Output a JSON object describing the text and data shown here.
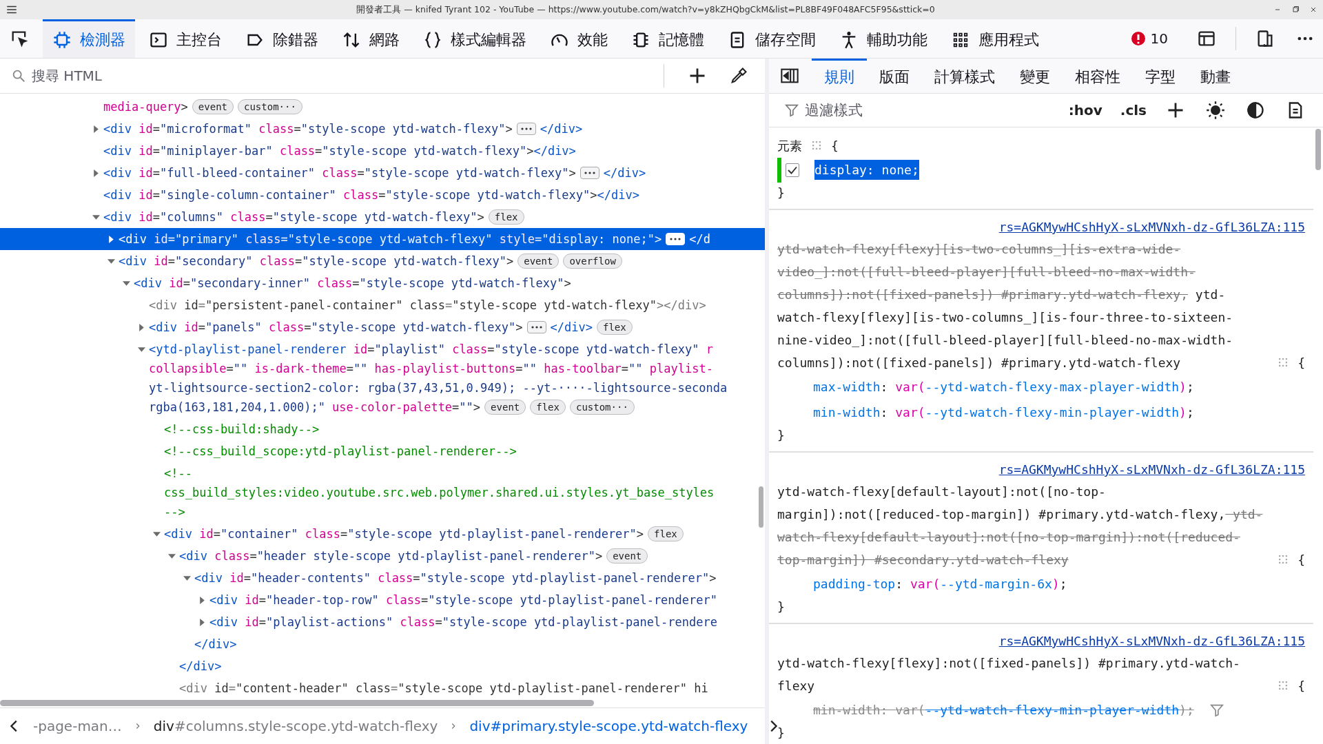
{
  "window": {
    "title": "開發者工具 — knifed Tyrant 102 - YouTube — https://www.youtube.com/watch?v=y8kZHQbgCkM&list=PL8BF49F048AFC5F95&sttick=0"
  },
  "toolbar": {
    "tools": [
      {
        "kind": "inspector",
        "label": "檢測器",
        "selected": true
      },
      {
        "kind": "console",
        "label": "主控台",
        "selected": false
      },
      {
        "kind": "debugger",
        "label": "除錯器",
        "selected": false
      },
      {
        "kind": "network",
        "label": "網路",
        "selected": false
      },
      {
        "kind": "style",
        "label": "樣式編輯器",
        "selected": false
      },
      {
        "kind": "performance",
        "label": "效能",
        "selected": false
      },
      {
        "kind": "memory",
        "label": "記憶體",
        "selected": false
      },
      {
        "kind": "storage",
        "label": "儲存空間",
        "selected": false
      },
      {
        "kind": "accessibility",
        "label": "輔助功能",
        "selected": false
      },
      {
        "kind": "application",
        "label": "應用程式",
        "selected": false
      }
    ],
    "error_count": "10"
  },
  "search": {
    "placeholder": "搜尋 HTML"
  },
  "markup": {
    "nodes": [
      {
        "kind": "leaf",
        "selected": false,
        "lines": [
          [
            {
              "kind": "attr",
              "text": "media-query"
            },
            {
              "kind": "punct",
              "text": ">"
            }
          ]
        ],
        "badges": [
          "event",
          "custom···"
        ]
      },
      {
        "kind": "branch",
        "expanded": false,
        "selected": false,
        "lines": [
          [
            {
              "kind": "tag",
              "text": "<div"
            },
            {
              "kind": "attr",
              "text": " id"
            },
            {
              "kind": "punct",
              "text": "="
            },
            {
              "kind": "val",
              "text": "\"microformat\""
            },
            {
              "kind": "attr",
              "text": " class"
            },
            {
              "kind": "punct",
              "text": "="
            },
            {
              "kind": "val",
              "text": "\"style-scope ytd-watch-flexy\""
            },
            {
              "kind": "punct",
              "text": ">"
            }
          ]
        ],
        "tail": [
          {
            "kind": "tag",
            "text": "</div>"
          }
        ]
      },
      {
        "kind": "leaf",
        "selected": false,
        "lines": [
          [
            {
              "kind": "tag",
              "text": "<div"
            },
            {
              "kind": "attr",
              "text": " id"
            },
            {
              "kind": "punct",
              "text": "="
            },
            {
              "kind": "val",
              "text": "\"miniplayer-bar\""
            },
            {
              "kind": "attr",
              "text": " class"
            },
            {
              "kind": "punct",
              "text": "="
            },
            {
              "kind": "val",
              "text": "\"style-scope ytd-watch-flexy\""
            },
            {
              "kind": "punct",
              "text": ">"
            },
            {
              "kind": "tag",
              "text": "</div>"
            }
          ]
        ]
      },
      {
        "kind": "branch",
        "expanded": false,
        "selected": false,
        "lines": [
          [
            {
              "kind": "tag",
              "text": "<div"
            },
            {
              "kind": "attr",
              "text": " id"
            },
            {
              "kind": "punct",
              "text": "="
            },
            {
              "kind": "val",
              "text": "\"full-bleed-container\""
            },
            {
              "kind": "attr",
              "text": " class"
            },
            {
              "kind": "punct",
              "text": "="
            },
            {
              "kind": "val",
              "text": "\"style-scope ytd-watch-flexy\""
            },
            {
              "kind": "punct",
              "text": ">"
            }
          ]
        ],
        "tail": [
          {
            "kind": "tag",
            "text": "</div>"
          }
        ]
      },
      {
        "kind": "leaf",
        "selected": false,
        "lines": [
          [
            {
              "kind": "tag",
              "text": "<div"
            },
            {
              "kind": "attr",
              "text": " id"
            },
            {
              "kind": "punct",
              "text": "="
            },
            {
              "kind": "val",
              "text": "\"single-column-container\""
            },
            {
              "kind": "attr",
              "text": " class"
            },
            {
              "kind": "punct",
              "text": "="
            },
            {
              "kind": "val",
              "text": "\"style-scope ytd-watch-flexy\""
            },
            {
              "kind": "punct",
              "text": ">"
            },
            {
              "kind": "tag",
              "text": "</div>"
            }
          ]
        ]
      },
      {
        "kind": "branch",
        "expanded": true,
        "selected": false,
        "lines": [
          [
            {
              "kind": "tag",
              "text": "<div"
            },
            {
              "kind": "attr",
              "text": " id"
            },
            {
              "kind": "punct",
              "text": "="
            },
            {
              "kind": "val",
              "text": "\"columns\""
            },
            {
              "kind": "attr",
              "text": " class"
            },
            {
              "kind": "punct",
              "text": "="
            },
            {
              "kind": "val",
              "text": "\"style-scope ytd-watch-flexy\""
            },
            {
              "kind": "punct",
              "text": ">"
            }
          ]
        ],
        "badges": [
          "flex"
        ],
        "children": [
          {
            "kind": "branch",
            "expanded": false,
            "selected": true,
            "lines": [
              [
                {
                  "kind": "tag",
                  "text": "<div"
                },
                {
                  "kind": "attr",
                  "text": " id"
                },
                {
                  "kind": "punct",
                  "text": "="
                },
                {
                  "kind": "val",
                  "text": "\"primary\""
                },
                {
                  "kind": "attr",
                  "text": " class"
                },
                {
                  "kind": "punct",
                  "text": "="
                },
                {
                  "kind": "val",
                  "text": "\"style-scope ytd-watch-flexy\""
                },
                {
                  "kind": "attr",
                  "text": " style"
                },
                {
                  "kind": "punct",
                  "text": "="
                },
                {
                  "kind": "val",
                  "text": "\"display: none;\""
                },
                {
                  "kind": "punct",
                  "text": ">"
                }
              ]
            ],
            "tail": [
              {
                "kind": "tag",
                "text": "</d"
              }
            ]
          },
          {
            "kind": "branch",
            "expanded": true,
            "selected": false,
            "lines": [
              [
                {
                  "kind": "tag",
                  "text": "<div"
                },
                {
                  "kind": "attr",
                  "text": " id"
                },
                {
                  "kind": "punct",
                  "text": "="
                },
                {
                  "kind": "val",
                  "text": "\"secondary\""
                },
                {
                  "kind": "attr",
                  "text": " class"
                },
                {
                  "kind": "punct",
                  "text": "="
                },
                {
                  "kind": "val",
                  "text": "\"style-scope ytd-watch-flexy\""
                },
                {
                  "kind": "punct",
                  "text": ">"
                }
              ]
            ],
            "badges": [
              "event",
              "overflow"
            ],
            "children": [
              {
                "kind": "branch",
                "expanded": true,
                "selected": false,
                "lines": [
                  [
                    {
                      "kind": "tag",
                      "text": "<div"
                    },
                    {
                      "kind": "attr",
                      "text": " id"
                    },
                    {
                      "kind": "punct",
                      "text": "="
                    },
                    {
                      "kind": "val",
                      "text": "\"secondary-inner\""
                    },
                    {
                      "kind": "attr",
                      "text": " class"
                    },
                    {
                      "kind": "punct",
                      "text": "="
                    },
                    {
                      "kind": "val",
                      "text": "\"style-scope ytd-watch-flexy\""
                    },
                    {
                      "kind": "punct",
                      "text": ">"
                    }
                  ]
                ],
                "children": [
                  {
                    "kind": "leaf",
                    "selected": false,
                    "lines": [
                      [
                        {
                          "kind": "dim",
                          "text": "<div"
                        },
                        {
                          "kind": "plain",
                          "text": " id"
                        },
                        {
                          "kind": "dim",
                          "text": "="
                        },
                        {
                          "kind": "plain",
                          "text": "\"persistent-panel-container\""
                        },
                        {
                          "kind": "plain",
                          "text": " class"
                        },
                        {
                          "kind": "dim",
                          "text": "="
                        },
                        {
                          "kind": "plain",
                          "text": "\"style-scope ytd-watch-flexy\""
                        },
                        {
                          "kind": "dim",
                          "text": "></div>"
                        }
                      ]
                    ]
                  },
                  {
                    "kind": "branch",
                    "expanded": false,
                    "selected": false,
                    "lines": [
                      [
                        {
                          "kind": "tag",
                          "text": "<div"
                        },
                        {
                          "kind": "attr",
                          "text": " id"
                        },
                        {
                          "kind": "punct",
                          "text": "="
                        },
                        {
                          "kind": "val",
                          "text": "\"panels\""
                        },
                        {
                          "kind": "attr",
                          "text": " class"
                        },
                        {
                          "kind": "punct",
                          "text": "="
                        },
                        {
                          "kind": "val",
                          "text": "\"style-scope ytd-watch-flexy\""
                        },
                        {
                          "kind": "punct",
                          "text": ">"
                        }
                      ]
                    ],
                    "tail": [
                      {
                        "kind": "tag",
                        "text": "</div>"
                      }
                    ],
                    "badges": [
                      "flex"
                    ]
                  },
                  {
                    "kind": "branch",
                    "expanded": true,
                    "selected": false,
                    "lines": [
                      [
                        {
                          "kind": "tag",
                          "text": "<ytd-playlist-panel-renderer"
                        },
                        {
                          "kind": "attr",
                          "text": " id"
                        },
                        {
                          "kind": "punct",
                          "text": "="
                        },
                        {
                          "kind": "val",
                          "text": "\"playlist\""
                        },
                        {
                          "kind": "attr",
                          "text": " class"
                        },
                        {
                          "kind": "punct",
                          "text": "="
                        },
                        {
                          "kind": "val",
                          "text": "\"style-scope ytd-watch-flexy\""
                        },
                        {
                          "kind": "attr",
                          "text": " r"
                        }
                      ],
                      [
                        {
                          "kind": "attr",
                          "text": "collapsible"
                        },
                        {
                          "kind": "punct",
                          "text": "="
                        },
                        {
                          "kind": "val",
                          "text": "\"\""
                        },
                        {
                          "kind": "attr",
                          "text": " is-dark-theme"
                        },
                        {
                          "kind": "punct",
                          "text": "="
                        },
                        {
                          "kind": "val",
                          "text": "\"\""
                        },
                        {
                          "kind": "attr",
                          "text": " has-playlist-buttons"
                        },
                        {
                          "kind": "punct",
                          "text": "="
                        },
                        {
                          "kind": "val",
                          "text": "\"\""
                        },
                        {
                          "kind": "attr",
                          "text": " has-toolbar"
                        },
                        {
                          "kind": "punct",
                          "text": "="
                        },
                        {
                          "kind": "val",
                          "text": "\"\""
                        },
                        {
                          "kind": "attr",
                          "text": " playlist-"
                        }
                      ],
                      [
                        {
                          "kind": "val",
                          "text": "yt-lightsource-section2-color: rgba(37,43,51,0.949); --yt-····-lightsource-seconda"
                        }
                      ],
                      [
                        {
                          "kind": "val",
                          "text": "rgba(163,181,204,1.000);\""
                        },
                        {
                          "kind": "attr",
                          "text": " use-color-palette"
                        },
                        {
                          "kind": "punct",
                          "text": "="
                        },
                        {
                          "kind": "val",
                          "text": "\"\""
                        },
                        {
                          "kind": "punct",
                          "text": ">"
                        }
                      ]
                    ],
                    "badges": [
                      "event",
                      "flex",
                      "custom···"
                    ],
                    "children": [
                      {
                        "kind": "comment",
                        "selected": false,
                        "lines": [
                          [
                            {
                              "kind": "comment",
                              "text": "<!--css-build:shady-->"
                            }
                          ]
                        ]
                      },
                      {
                        "kind": "comment",
                        "selected": false,
                        "lines": [
                          [
                            {
                              "kind": "comment",
                              "text": "<!--css_build_scope:ytd-playlist-panel-renderer-->"
                            }
                          ]
                        ]
                      },
                      {
                        "kind": "comment",
                        "selected": false,
                        "lines": [
                          [
                            {
                              "kind": "comment",
                              "text": "<!--"
                            }
                          ],
                          [
                            {
                              "kind": "comment",
                              "text": "css_build_styles:video.youtube.src.web.polymer.shared.ui.styles.yt_base_styles"
                            }
                          ],
                          [
                            {
                              "kind": "comment",
                              "text": "-->"
                            }
                          ]
                        ]
                      },
                      {
                        "kind": "branch",
                        "expanded": true,
                        "selected": false,
                        "lines": [
                          [
                            {
                              "kind": "tag",
                              "text": "<div"
                            },
                            {
                              "kind": "attr",
                              "text": " id"
                            },
                            {
                              "kind": "punct",
                              "text": "="
                            },
                            {
                              "kind": "val",
                              "text": "\"container\""
                            },
                            {
                              "kind": "attr",
                              "text": " class"
                            },
                            {
                              "kind": "punct",
                              "text": "="
                            },
                            {
                              "kind": "val",
                              "text": "\"style-scope ytd-playlist-panel-renderer\""
                            },
                            {
                              "kind": "punct",
                              "text": ">"
                            }
                          ]
                        ],
                        "badges": [
                          "flex"
                        ],
                        "children": [
                          {
                            "kind": "branch",
                            "expanded": true,
                            "selected": false,
                            "lines": [
                              [
                                {
                                  "kind": "tag",
                                  "text": "<div"
                                },
                                {
                                  "kind": "attr",
                                  "text": " class"
                                },
                                {
                                  "kind": "punct",
                                  "text": "="
                                },
                                {
                                  "kind": "val",
                                  "text": "\"header style-scope ytd-playlist-panel-renderer\""
                                },
                                {
                                  "kind": "punct",
                                  "text": ">"
                                }
                              ]
                            ],
                            "badges": [
                              "event"
                            ],
                            "closing": [
                              {
                                "kind": "tag",
                                "text": "</div>"
                              }
                            ],
                            "children": [
                              {
                                "kind": "branch",
                                "expanded": true,
                                "selected": false,
                                "lines": [
                                  [
                                    {
                                      "kind": "tag",
                                      "text": "<div"
                                    },
                                    {
                                      "kind": "attr",
                                      "text": " id"
                                    },
                                    {
                                      "kind": "punct",
                                      "text": "="
                                    },
                                    {
                                      "kind": "val",
                                      "text": "\"header-contents\""
                                    },
                                    {
                                      "kind": "attr",
                                      "text": " class"
                                    },
                                    {
                                      "kind": "punct",
                                      "text": "="
                                    },
                                    {
                                      "kind": "val",
                                      "text": "\"style-scope ytd-playlist-panel-renderer\""
                                    },
                                    {
                                      "kind": "punct",
                                      "text": ">"
                                    }
                                  ]
                                ],
                                "closing": [
                                  {
                                    "kind": "tag",
                                    "text": "</div>"
                                  }
                                ],
                                "children": [
                                  {
                                    "kind": "branch",
                                    "expanded": false,
                                    "selected": false,
                                    "lines": [
                                      [
                                        {
                                          "kind": "tag",
                                          "text": "<div"
                                        },
                                        {
                                          "kind": "attr",
                                          "text": " id"
                                        },
                                        {
                                          "kind": "punct",
                                          "text": "="
                                        },
                                        {
                                          "kind": "val",
                                          "text": "\"header-top-row\""
                                        },
                                        {
                                          "kind": "attr",
                                          "text": " class"
                                        },
                                        {
                                          "kind": "punct",
                                          "text": "="
                                        },
                                        {
                                          "kind": "val",
                                          "text": "\"style-scope ytd-playlist-panel-renderer\""
                                        }
                                      ]
                                    ]
                                  },
                                  {
                                    "kind": "branch",
                                    "expanded": false,
                                    "selected": false,
                                    "lines": [
                                      [
                                        {
                                          "kind": "tag",
                                          "text": "<div"
                                        },
                                        {
                                          "kind": "attr",
                                          "text": " id"
                                        },
                                        {
                                          "kind": "punct",
                                          "text": "="
                                        },
                                        {
                                          "kind": "val",
                                          "text": "\"playlist-actions\""
                                        },
                                        {
                                          "kind": "attr",
                                          "text": " class"
                                        },
                                        {
                                          "kind": "punct",
                                          "text": "="
                                        },
                                        {
                                          "kind": "val",
                                          "text": "\"style-scope ytd-playlist-panel-rendere"
                                        }
                                      ]
                                    ]
                                  }
                                ]
                              }
                            ]
                          },
                          {
                            "kind": "leaf",
                            "selected": false,
                            "lines": [
                              [
                                {
                                  "kind": "dim",
                                  "text": "<div"
                                },
                                {
                                  "kind": "plain",
                                  "text": " id"
                                },
                                {
                                  "kind": "dim",
                                  "text": "="
                                },
                                {
                                  "kind": "plain",
                                  "text": "\"content-header\""
                                },
                                {
                                  "kind": "plain",
                                  "text": " class"
                                },
                                {
                                  "kind": "dim",
                                  "text": "="
                                },
                                {
                                  "kind": "plain",
                                  "text": "\"style-scope ytd-playlist-panel-renderer\""
                                },
                                {
                                  "kind": "plain",
                                  "text": " hi"
                                }
                              ]
                            ]
                          }
                        ]
                      }
                    ]
                  }
                ]
              }
            ]
          }
        ]
      }
    ]
  },
  "breadcrumbs": [
    {
      "rest": "-page-man…",
      "selected": false
    },
    {
      "tag": "div",
      "rest": "#columns.style-scope.ytd-watch-flexy",
      "selected": false
    },
    {
      "tag": "div",
      "rest": "#primary.style-scope.ytd-watch-flexy",
      "selected": true
    }
  ],
  "sidebar": {
    "tabs": [
      {
        "label": "規則",
        "selected": true
      },
      {
        "label": "版面",
        "selected": false
      },
      {
        "label": "計算樣式",
        "selected": false
      },
      {
        "label": "變更",
        "selected": false
      },
      {
        "label": "相容性",
        "selected": false
      },
      {
        "label": "字型",
        "selected": false
      },
      {
        "label": "動畫",
        "selected": false
      }
    ],
    "filter": {
      "placeholder": "過濾樣式"
    },
    "pseudo_toggle": ":hov",
    "class_toggle": ".cls"
  },
  "rules": [
    {
      "kind": "element",
      "selector": [
        {
          "text": "元素",
          "matched": true
        }
      ],
      "open_brace": "{",
      "close_brace": "}",
      "declarations": [
        {
          "checked": true,
          "changed": true,
          "selected": true,
          "overridden": false,
          "segments": [
            {
              "kind": "prop",
              "text": "display"
            },
            {
              "kind": "punct",
              "text": ": "
            },
            {
              "kind": "plain",
              "text": "none"
            },
            {
              "kind": "punct",
              "text": ";"
            }
          ]
        }
      ]
    },
    {
      "kind": "stylesheet",
      "source": "rs=AGKMywHCshHyX-sLxMVNxh-dz-GfL36LZA:115",
      "selector": [
        {
          "text": "ytd-watch-flexy[flexy][is-two-columns_][is-extra-wide-video_]:not([full-bleed-player][full-bleed-no-max-width-columns]):not([fixed-panels]) #primary.ytd-watch-flexy,",
          "matched": false
        },
        {
          "text": " ytd-watch-flexy[flexy][is-two-columns_][is-four-three-to-sixteen-nine-video_]:not([full-bleed-player][full-bleed-no-max-width-columns]):not([fixed-panels]) #primary.ytd-watch-flexy",
          "matched": true
        }
      ],
      "open_brace": "{",
      "close_brace": "}",
      "declarations": [
        {
          "overridden": false,
          "segments": [
            {
              "kind": "prop",
              "text": "max-width"
            },
            {
              "kind": "punct",
              "text": ": "
            },
            {
              "kind": "fn",
              "text": "var("
            },
            {
              "kind": "var",
              "text": "--ytd-watch-flexy-max-player-width"
            },
            {
              "kind": "fn",
              "text": ")"
            },
            {
              "kind": "punct",
              "text": ";"
            }
          ]
        },
        {
          "overridden": false,
          "segments": [
            {
              "kind": "prop",
              "text": "min-width"
            },
            {
              "kind": "punct",
              "text": ": "
            },
            {
              "kind": "fn",
              "text": "var("
            },
            {
              "kind": "var",
              "text": "--ytd-watch-flexy-min-player-width"
            },
            {
              "kind": "fn",
              "text": ")"
            },
            {
              "kind": "punct",
              "text": ";"
            }
          ]
        }
      ]
    },
    {
      "kind": "stylesheet",
      "source": "rs=AGKMywHCshHyX-sLxMVNxh-dz-GfL36LZA:115",
      "selector": [
        {
          "text": "ytd-watch-flexy[default-layout]:not([no-top-margin]):not([reduced-top-margin]) #primary.ytd-watch-flexy,",
          "matched": true
        },
        {
          "text": " ytd-watch-flexy[default-layout]:not([no-top-margin]):not([reduced-top-margin]) #secondary.ytd-watch-flexy",
          "matched": false
        }
      ],
      "open_brace": "{",
      "close_brace": "}",
      "declarations": [
        {
          "overridden": false,
          "segments": [
            {
              "kind": "prop",
              "text": "padding-top"
            },
            {
              "kind": "punct",
              "text": ": "
            },
            {
              "kind": "fn",
              "text": "var("
            },
            {
              "kind": "var",
              "text": "--ytd-margin-6x"
            },
            {
              "kind": "fn",
              "text": ")"
            },
            {
              "kind": "punct",
              "text": ";"
            }
          ]
        }
      ]
    },
    {
      "kind": "stylesheet",
      "source": "rs=AGKMywHCshHyX-sLxMVNxh-dz-GfL36LZA:115",
      "selector": [
        {
          "text": "ytd-watch-flexy[flexy]:not([fixed-panels]) #primary.ytd-watch-flexy",
          "matched": true
        }
      ],
      "open_brace": "{",
      "close_brace": "}",
      "declarations": [
        {
          "overridden": true,
          "segments": [
            {
              "kind": "prop",
              "text": "min-width"
            },
            {
              "kind": "punct",
              "text": ": "
            },
            {
              "kind": "fn",
              "text": "var("
            },
            {
              "kind": "var",
              "text": "--ytd-watch-flexy-min-player-width"
            },
            {
              "kind": "fn",
              "text": ")"
            },
            {
              "kind": "punct",
              "text": ";"
            }
          ]
        }
      ]
    }
  ]
}
